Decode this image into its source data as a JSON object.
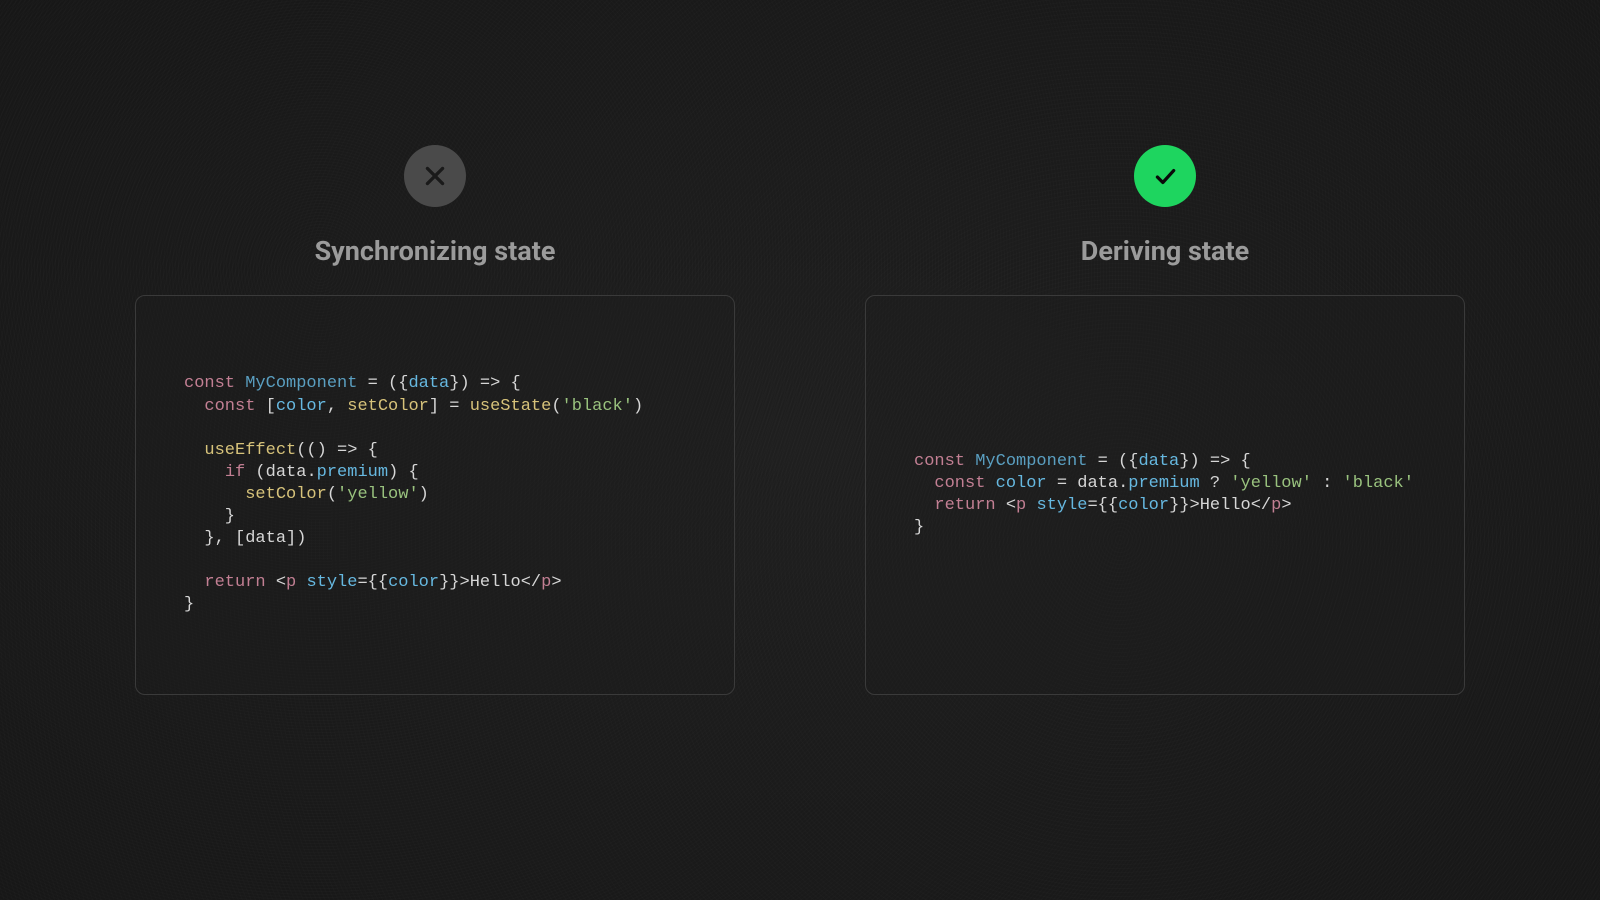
{
  "left": {
    "title": "Synchronizing state",
    "badge": "cross",
    "code": {
      "component": "MyComponent",
      "param": "data",
      "stateVar": "color",
      "setter": "setColor",
      "hook": "useState",
      "effect": "useEffect",
      "initial": "'black'",
      "premiumProp": "premium",
      "dataProp": "data",
      "setVal": "'yellow'",
      "dep": "data",
      "tagName": "p",
      "attr": "style",
      "text": "Hello"
    }
  },
  "right": {
    "title": "Deriving state",
    "badge": "check",
    "code": {
      "component": "MyComponent",
      "param": "data",
      "varName": "color",
      "dataProp": "data",
      "premiumProp": "premium",
      "valTrue": "'yellow'",
      "valFalse": "'black'",
      "tagName": "p",
      "attr": "style",
      "text": "Hello"
    }
  },
  "colors": {
    "bg": "#1a1a1a",
    "panelBorder": "#3a3a3a",
    "badgeBad": "#4a4a4a",
    "badgeGood": "#1ed55f",
    "title": "#9b9b9b"
  }
}
